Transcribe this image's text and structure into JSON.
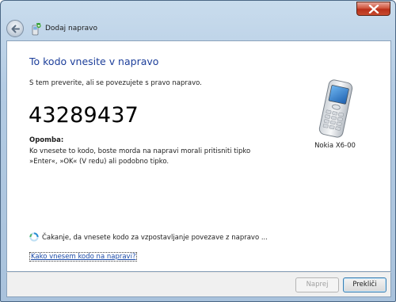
{
  "window": {
    "title": "Dodaj napravo"
  },
  "page": {
    "heading": "To kodo vnesite v napravo",
    "description": "S tem preverite, ali se povezujete s pravo napravo.",
    "code": "43289437",
    "note_title": "Opomba:",
    "note_line1": "Ko vnesete to kodo, boste morda na napravi morali pritisniti tipko",
    "note_line2": "»Enter«, »OK« (V redu) ali podobno tipko.",
    "status": "Čakanje, da vnesete kodo za vzpostavljanje povezave z napravo ...",
    "help_link": "Kako vnesem kodo na napravi?"
  },
  "device": {
    "name": "Nokia X6-00",
    "icon": "mobile-phone-icon"
  },
  "buttons": {
    "next": "Naprej",
    "cancel": "Prekliči"
  },
  "icons": {
    "back": "back-arrow-icon",
    "title": "bluetooth-device-icon",
    "close": "close-icon",
    "status": "busy-spinner-icon"
  },
  "colors": {
    "heading": "#1c3e9a",
    "link": "#1a4aa8",
    "close_button": "#c84a2e",
    "frame": "#b3cbe3"
  }
}
